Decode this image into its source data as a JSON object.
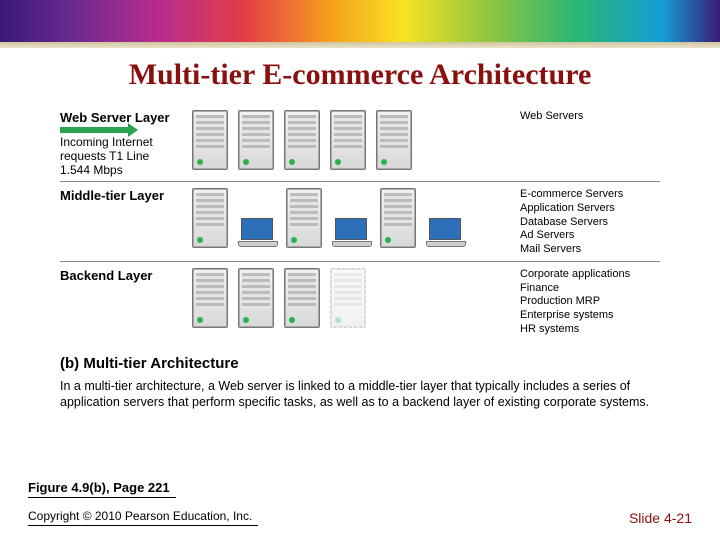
{
  "title": "Multi-tier E-commerce Architecture",
  "layers": {
    "web": {
      "name": "Web Server Layer",
      "inflow_l1": "Incoming Internet",
      "inflow_l2": "requests T1 Line",
      "inflow_l3": "1.544 Mbps",
      "right": "Web Servers"
    },
    "mid": {
      "name": "Middle-tier Layer",
      "right_l1": "E-commerce Servers",
      "right_l2": "Application Servers",
      "right_l3": "Database Servers",
      "right_l4": "Ad Servers",
      "right_l5": "Mail Servers"
    },
    "back": {
      "name": "Backend Layer",
      "right_l1": "Corporate applications",
      "right_l2": "Finance",
      "right_l3": "Production MRP",
      "right_l4": "Enterprise systems",
      "right_l5": "HR systems"
    }
  },
  "arch_label": "(b)  Multi-tier Architecture",
  "arch_desc": "In a multi-tier architecture, a Web server is linked to a middle-tier layer that typically includes a series of application servers that perform specific tasks, as well as to a backend layer of existing corporate systems.",
  "fig_ref": "Figure 4.9(b), Page 221",
  "copyright": "Copyright © 2010 Pearson Education, Inc.",
  "slide_num": "Slide 4-21"
}
